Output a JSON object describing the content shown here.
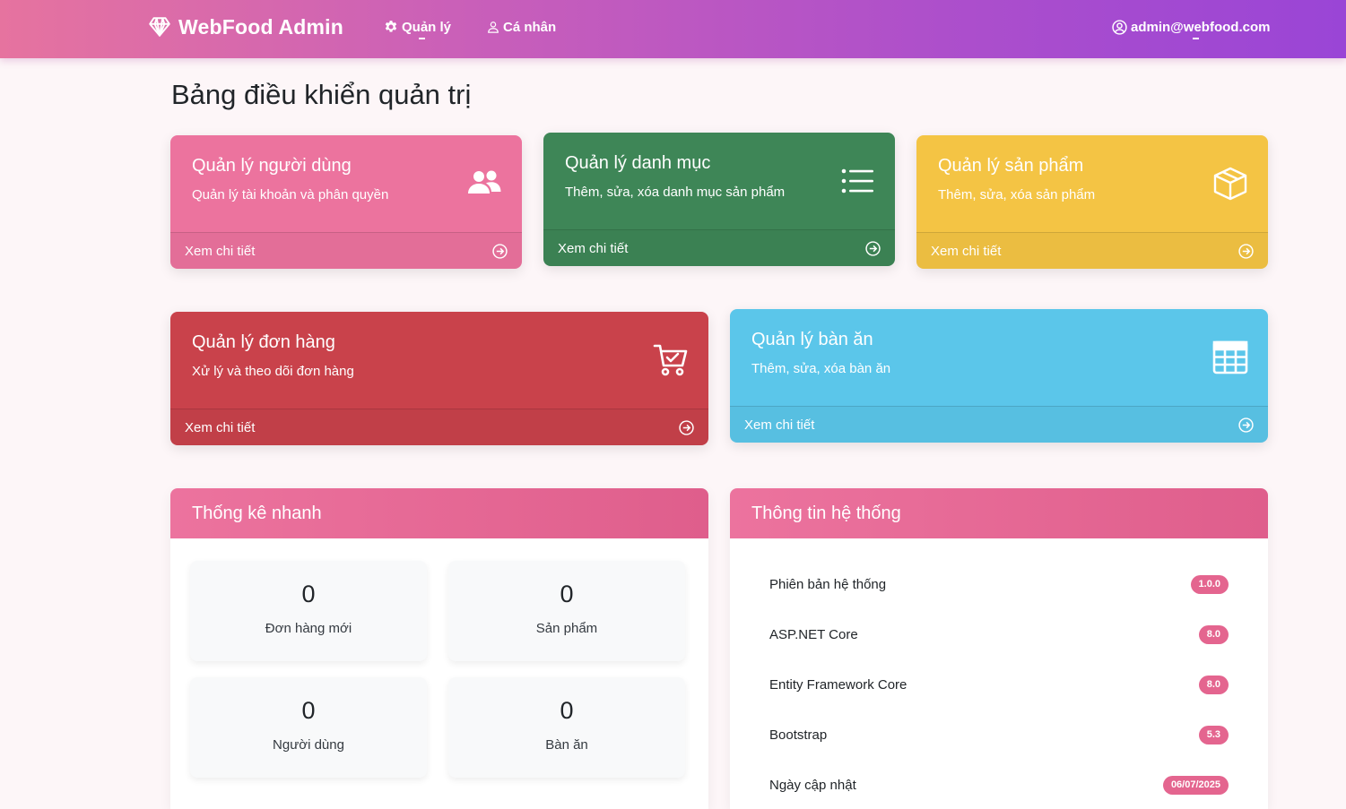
{
  "navbar": {
    "brand": "WebFood Admin",
    "manage_label": "Quản lý",
    "personal_label": "Cá nhân",
    "user_email": "admin@webfood.com",
    "bg_gradient": [
      "#e6739f",
      "#9a45d6"
    ]
  },
  "page": {
    "title": "Bảng điều khiển quản trị"
  },
  "cards": [
    {
      "title": "Quản lý người dùng",
      "subtitle": "Quản lý tài khoản và phân quyền",
      "link": "Xem chi tiết",
      "color": "#ec739e",
      "icon": "users-icon"
    },
    {
      "title": "Quản lý danh mục",
      "subtitle": "Thêm, sửa, xóa danh mục sản phẩm",
      "link": "Xem chi tiết",
      "color": "#3e8657",
      "icon": "list-icon"
    },
    {
      "title": "Quản lý sản phẩm",
      "subtitle": "Thêm, sửa, xóa sản phẩm",
      "link": "Xem chi tiết",
      "color": "#f4c444",
      "icon": "box-icon"
    },
    {
      "title": "Quản lý đơn hàng",
      "subtitle": "Xử lý và theo dõi đơn hàng",
      "link": "Xem chi tiết",
      "color": "#c9424b",
      "icon": "cart-check-icon"
    },
    {
      "title": "Quản lý bàn ăn",
      "subtitle": "Thêm, sửa, xóa bàn ăn",
      "link": "Xem chi tiết",
      "color": "#5bc6ea",
      "icon": "table-grid-icon"
    }
  ],
  "stats_panel": {
    "title": "Thống kê nhanh",
    "items": [
      {
        "value": "0",
        "label": "Đơn hàng mới"
      },
      {
        "value": "0",
        "label": "Sản phẩm"
      },
      {
        "value": "0",
        "label": "Người dùng"
      },
      {
        "value": "0",
        "label": "Bàn ăn"
      }
    ]
  },
  "info_panel": {
    "title": "Thông tin hệ thống",
    "rows": [
      {
        "label": "Phiên bản hệ thống",
        "badge": "1.0.0"
      },
      {
        "label": "ASP.NET Core",
        "badge": "8.0"
      },
      {
        "label": "Entity Framework Core",
        "badge": "8.0"
      },
      {
        "label": "Bootstrap",
        "badge": "5.3"
      },
      {
        "label": "Ngày cập nhật",
        "badge": "06/07/2025"
      }
    ],
    "badge_color": "#e4658f"
  }
}
